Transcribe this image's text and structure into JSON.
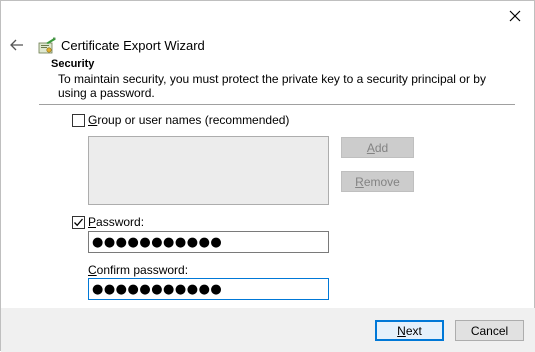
{
  "window": {
    "title": "Certificate Export Wizard"
  },
  "section": {
    "title": "Security",
    "description": "To maintain security, you must protect the private key to a security principal or by using a password."
  },
  "group_option": {
    "label_access": "G",
    "label_rest": "roup or user names (recommended)",
    "checked": false
  },
  "side_buttons": {
    "add_access": "A",
    "add_rest": "dd",
    "remove_access": "R",
    "remove_rest": "emove"
  },
  "password_option": {
    "label_access": "P",
    "label_rest": "assword:",
    "checked": true,
    "value": "●●●●●●●●●●●"
  },
  "confirm": {
    "label_pre": "",
    "label_access": "C",
    "label_rest": "onfirm password:",
    "value": "●●●●●●●●●●●"
  },
  "footer": {
    "next_access": "N",
    "next_rest": "ext",
    "cancel_label": "Cancel"
  },
  "icons": {
    "close": "close-icon",
    "back": "back-arrow-icon",
    "wizard": "certificate-wizard-icon",
    "check": "checkmark-icon"
  },
  "colors": {
    "accent": "#0078d7",
    "disabled_button": "#cccccc",
    "footer_bg": "#f0f0f0"
  }
}
